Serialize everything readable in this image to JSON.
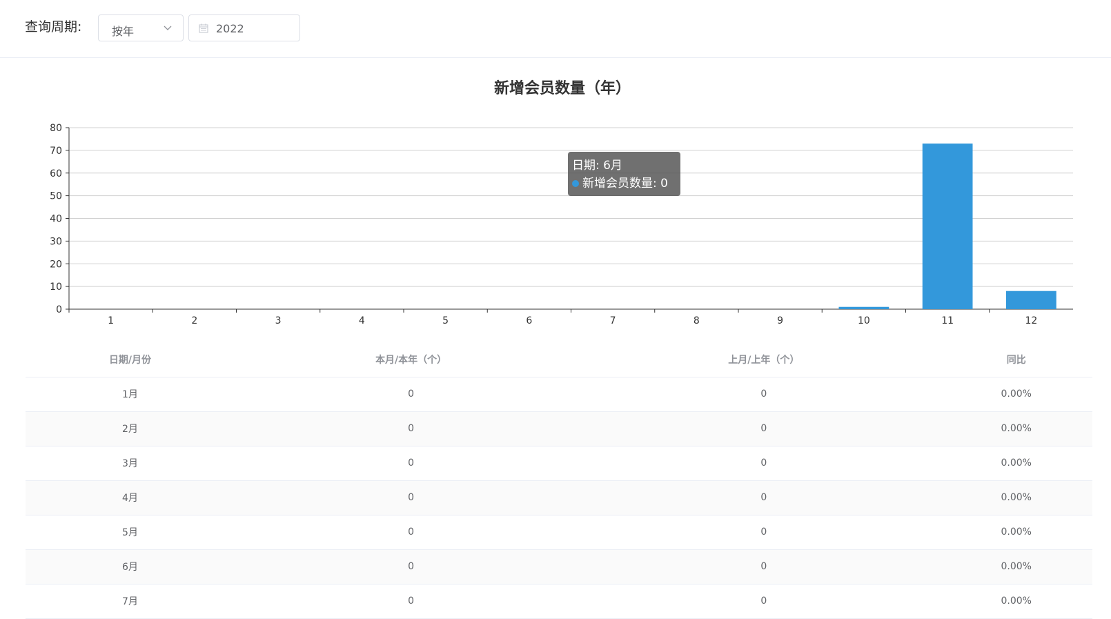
{
  "filter": {
    "label": "查询周期:",
    "period_select": "按年",
    "year_value": "2022"
  },
  "chart_data": {
    "type": "bar",
    "title": "新增会员数量（年）",
    "categories": [
      "1",
      "2",
      "3",
      "4",
      "5",
      "6",
      "7",
      "8",
      "9",
      "10",
      "11",
      "12"
    ],
    "series": [
      {
        "name": "新增会员数量",
        "values": [
          0,
          0,
          0,
          0,
          0,
          0,
          0,
          0,
          0,
          1,
          73,
          8
        ]
      }
    ],
    "ylim": [
      0,
      80
    ],
    "yticks": [
      0,
      10,
      20,
      30,
      40,
      50,
      60,
      70,
      80
    ],
    "grid": true,
    "bar_color": "#3398DB",
    "tooltip": {
      "date_line": "日期: 6月",
      "value_line": "新增会员数量: 0"
    }
  },
  "table": {
    "headers": [
      "日期/月份",
      "本月/本年（个）",
      "上月/上年（个）",
      "同比"
    ],
    "rows": [
      [
        "1月",
        "0",
        "0",
        "0.00%"
      ],
      [
        "2月",
        "0",
        "0",
        "0.00%"
      ],
      [
        "3月",
        "0",
        "0",
        "0.00%"
      ],
      [
        "4月",
        "0",
        "0",
        "0.00%"
      ],
      [
        "5月",
        "0",
        "0",
        "0.00%"
      ],
      [
        "6月",
        "0",
        "0",
        "0.00%"
      ],
      [
        "7月",
        "0",
        "0",
        "0.00%"
      ]
    ]
  }
}
